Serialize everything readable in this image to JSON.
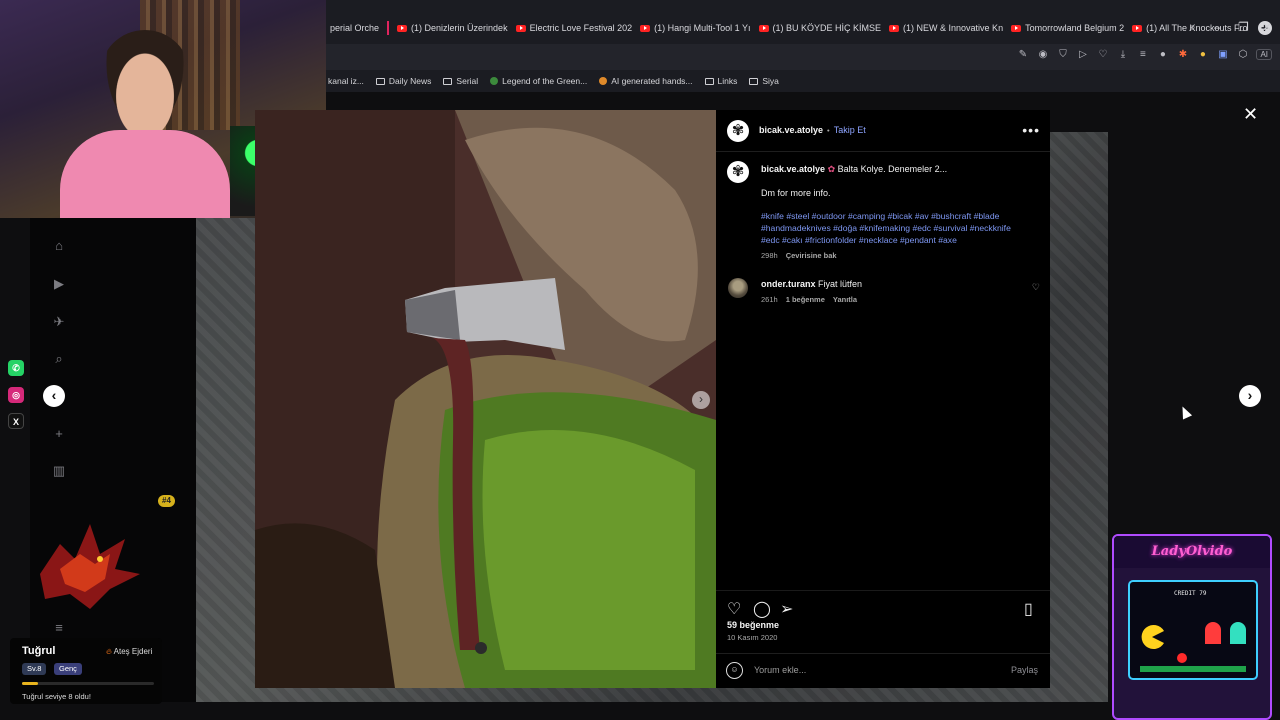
{
  "browser": {
    "tabs": [
      {
        "label": "perial Orche",
        "icon": "none"
      },
      {
        "label": "(1) Denizlerin Üzerindek",
        "icon": "youtube-icon"
      },
      {
        "label": "Electric Love Festival 202",
        "icon": "youtube-icon"
      },
      {
        "label": "(1) Hangi Multi-Tool 1 Yı",
        "icon": "youtube-icon"
      },
      {
        "label": "(1) BU KÖYDE HİÇ KİMSE",
        "icon": "youtube-icon"
      },
      {
        "label": "(1) NEW & Innovative Kn",
        "icon": "youtube-icon"
      },
      {
        "label": "Tomorrowland Belgium 2",
        "icon": "youtube-icon"
      },
      {
        "label": "(1) All The Knockouts Fro",
        "icon": "youtube-icon"
      }
    ],
    "ai_label": "AI",
    "bookmarks": [
      {
        "label": "kanal iz...",
        "type": "none"
      },
      {
        "label": "Daily News",
        "type": "folder"
      },
      {
        "label": "Serial",
        "type": "folder"
      },
      {
        "label": "Legend of the Green...",
        "type": "site"
      },
      {
        "label": "AI generated hands...",
        "type": "site"
      },
      {
        "label": "Links",
        "type": "folder"
      },
      {
        "label": "Siya",
        "type": "folder"
      }
    ]
  },
  "post": {
    "header": {
      "username": "bicak.ve.atolye",
      "separator": "•",
      "follow_label": "Takip Et"
    },
    "caption": {
      "username": "bicak.ve.atolye",
      "title": "Balta Kolye. Denemeler 2...",
      "line2": "Dm for more info.",
      "hashtags": "#knife #steel #outdoor #camping #bicak #av #bushcraft #blade #handmadeknives #doğa #knifemaking #edc #survival #neckknife #edc #cakı #frictionfolder #necklace #pendant #axe",
      "time": "298h",
      "translate": "Çevirisine bak"
    },
    "comments": [
      {
        "username": "onder.turanx",
        "text": "Fiyat lütfen",
        "time": "261h",
        "likes": "1 beğenme",
        "reply": "Yanıtla"
      }
    ],
    "likes": "59 beğenme",
    "date": "10 Kasım 2020",
    "comment_placeholder": "Yorum ekle...",
    "share_label": "Paylaş"
  },
  "overlay": {
    "user_name": "Tuğrul",
    "title_badge": "Ateş Ejderi",
    "level_chip": "Sv.8",
    "rank_chip": "Genç",
    "level_progress": 0.12,
    "message": "Tuğrul seviye 8 oldu!",
    "rank_badge": "#4",
    "arcade_title": "LadyOlvido",
    "arcade_credit": "CREDIT 79"
  },
  "colors": {
    "accent_link": "#8ea4ff",
    "hashtag": "#7e97f2",
    "chrome_bg": "#1b1c22"
  }
}
